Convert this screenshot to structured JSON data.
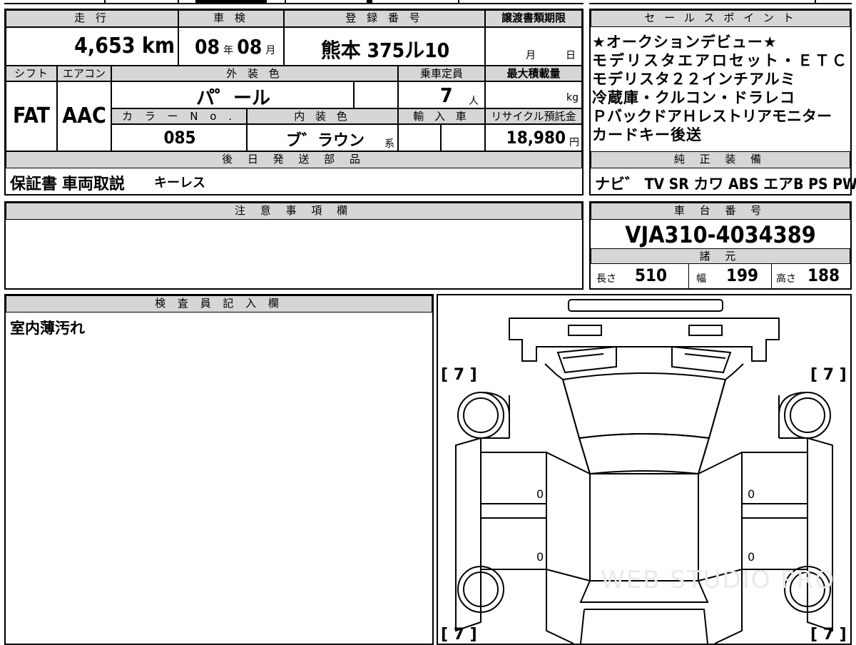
{
  "mileage": {
    "header": "走 行",
    "value": "4,653",
    "unit": "km"
  },
  "shaken": {
    "header": "車 検",
    "year": "08",
    "year_unit": "年",
    "month": "08",
    "month_unit": "月"
  },
  "registration": {
    "header": "登 録 番 号",
    "value": "熊本 375ル10"
  },
  "transfer_deadline": {
    "header": "譲渡書類期限",
    "month_unit": "月",
    "day_unit": "日"
  },
  "shift": {
    "header": "シフト",
    "value": "FAT"
  },
  "aircon": {
    "header": "エアコン",
    "value": "AAC"
  },
  "exterior_color": {
    "header": "外 装 色",
    "value": "パ゜ール"
  },
  "capacity": {
    "header": "乗車定員",
    "value": "7",
    "unit": "人"
  },
  "max_load": {
    "header": "最大積載量",
    "unit": "kg"
  },
  "color_no": {
    "header": "カ ラ ー N o .",
    "value": "085"
  },
  "interior_color": {
    "header": "内 装 色",
    "value": "ブ゛ラウン",
    "suffix": "系"
  },
  "import_car": {
    "header": "輸 入 車"
  },
  "recycle_fee": {
    "header": "リサイクル預託金",
    "value": "18,980",
    "unit": "円"
  },
  "sales_points": {
    "header": "セ ー ル ス ポ イ ン ト",
    "lines": [
      "★オークションデビュー★",
      "モデリスタエアロセット・ＥＴＣ",
      "モデリスタ２２インチアルミ",
      "冷蔵庫・クルコン・ドラレコ",
      "ＰバックドアＨレストリアモニター",
      "カードキー後送"
    ]
  },
  "later_parts": {
    "header": "後 日 発 送 部 品",
    "items": "保証書 車両取説",
    "extra": "キーレス"
  },
  "genuine_equipment": {
    "header": "純 正 装 備",
    "items": "ナビ゛ TV SR カワ ABS エアB PS PW"
  },
  "notes": {
    "header": "注 意 事 項 欄",
    "value": ""
  },
  "chassis": {
    "header": "車 台 番 号",
    "value": "VJA310-4034389"
  },
  "specs": {
    "header": "諸 元",
    "length_label": "長さ",
    "length": "510",
    "width_label": "幅",
    "width": "199",
    "height_label": "高さ",
    "height": "188"
  },
  "inspector": {
    "header": "検 査 員 記 入 欄",
    "comment": "室内薄汚れ"
  },
  "diagram": {
    "tire_fl": "[ 7 ]",
    "tire_fr": "[ 7 ]",
    "tire_rl": "[ 7 ]",
    "tire_rr": "[ 7 ]",
    "mark_l1": "0",
    "mark_l2": "0",
    "mark_r1": "0",
    "mark_r2": "0",
    "watermark": "WEB STUDIO PRO"
  }
}
